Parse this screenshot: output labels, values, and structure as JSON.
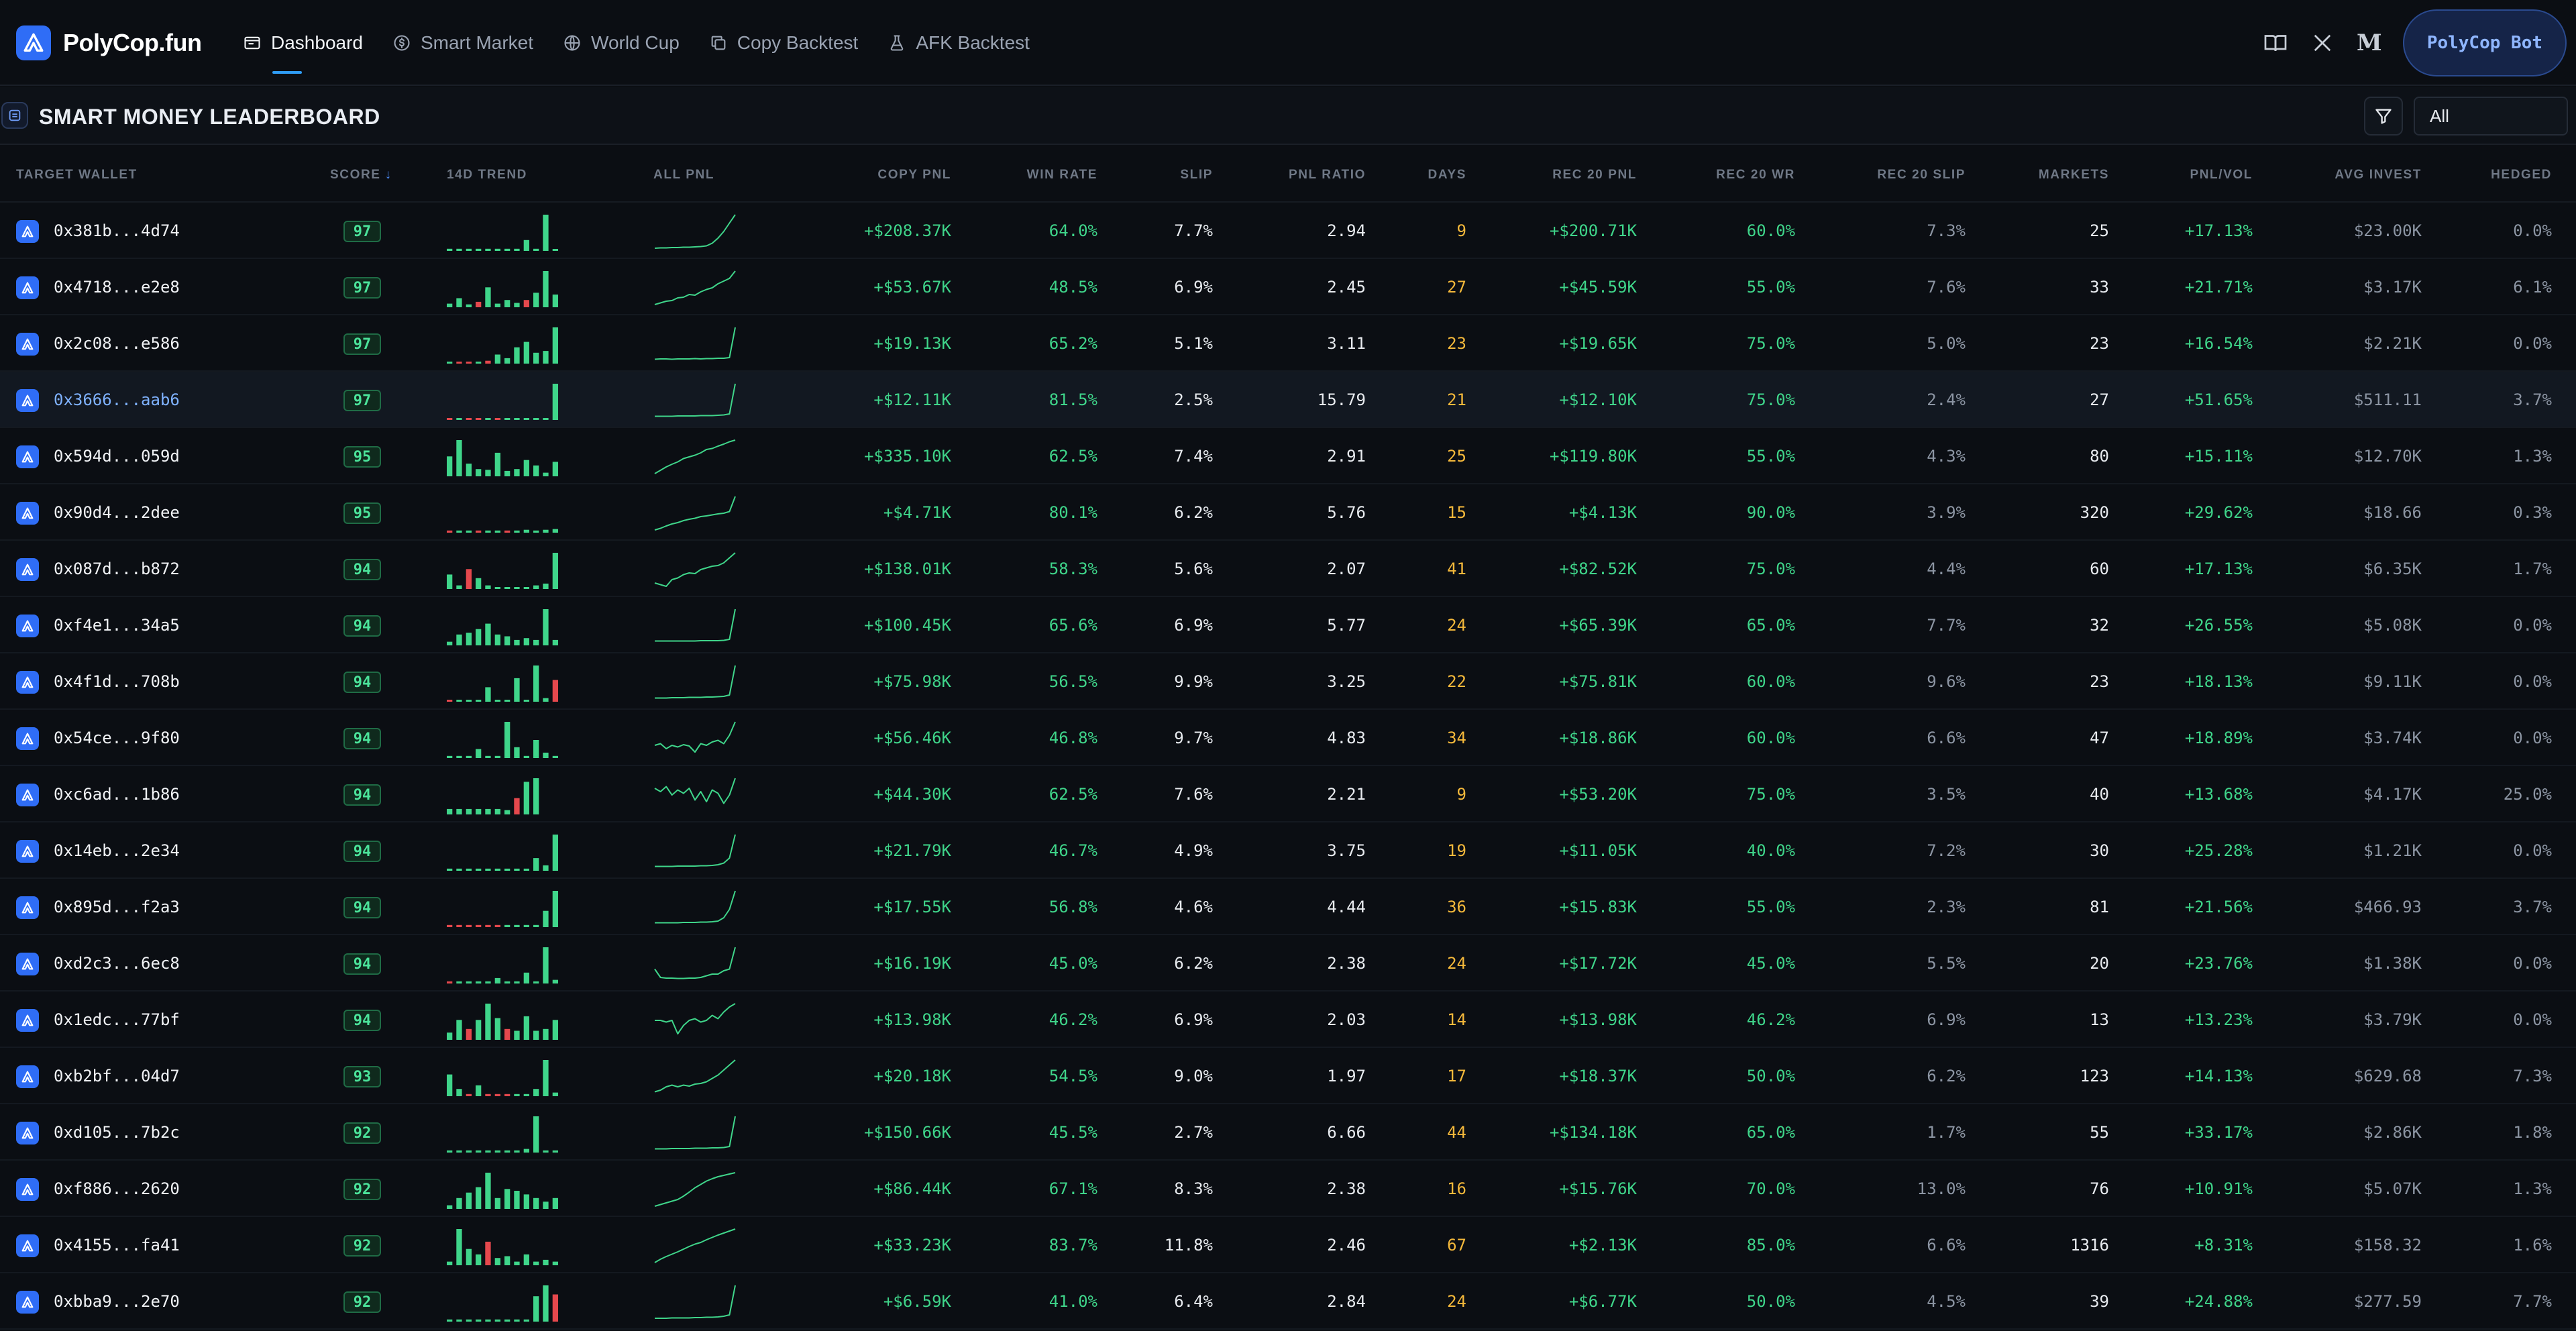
{
  "app": {
    "name": "PolyCop.fun",
    "bot_button": "PolyCop Bot"
  },
  "nav": {
    "tabs": [
      {
        "label": "Dashboard",
        "icon": "dashboard-icon",
        "active": true
      },
      {
        "label": "Smart Market",
        "icon": "dollar-circle-icon",
        "active": false
      },
      {
        "label": "World Cup",
        "icon": "globe-icon",
        "active": false
      },
      {
        "label": "Copy Backtest",
        "icon": "copy-icon",
        "active": false
      },
      {
        "label": "AFK Backtest",
        "icon": "flask-icon",
        "active": false
      }
    ],
    "right_icons": [
      "docs-book-icon",
      "x-twitter-icon",
      "medium-icon"
    ]
  },
  "section": {
    "title": "SMART MONEY LEADERBOARD",
    "filter_icon": "filter-icon",
    "filter_value": "All"
  },
  "colors": {
    "accent": "#2f6df6",
    "positive": "#3fd58a",
    "negative": "#e5484d",
    "days": "#f5b93b"
  },
  "table": {
    "columns": {
      "wallet": "TARGET WALLET",
      "score": "SCORE",
      "trend": "14D TREND",
      "allpnl": "ALL PNL",
      "copy": "COPY PNL",
      "wr": "WIN RATE",
      "slip": "SLIP",
      "ratio": "PNL RATIO",
      "days": "DAYS",
      "r20pnl": "REC 20 PNL",
      "r20wr": "REC 20 WR",
      "r20slip": "REC 20 SLIP",
      "markets": "MARKETS",
      "pv": "PNL/VOL",
      "avg": "AVG INVEST",
      "hedged": "HEDGED"
    },
    "sort": {
      "column": "SCORE",
      "direction": "desc"
    },
    "rows": [
      {
        "wallet": "0x381b...4d74",
        "score": "97",
        "copy": "+$208.37K",
        "wr": "64.0%",
        "slip": "7.7%",
        "ratio": "2.94",
        "days": "9",
        "r20pnl": "+$200.71K",
        "r20wr": "60.0%",
        "r20slip": "7.3%",
        "markets": "25",
        "pv": "+17.13%",
        "avg": "$23.00K",
        "hedged": "0.0%",
        "trend": [
          0.06,
          0.06,
          0.06,
          0.06,
          0.06,
          0.06,
          0.06,
          0.06,
          0.3,
          0.06,
          1.0,
          0.0
        ],
        "trend_neg": [],
        "pnl": [
          0.0,
          0.01,
          0.01,
          0.02,
          0.02,
          0.03,
          0.03,
          0.04,
          0.05,
          0.07,
          0.15,
          0.3,
          0.5,
          0.75,
          1.0
        ]
      },
      {
        "wallet": "0x4718...e2e8",
        "score": "97",
        "copy": "+$53.67K",
        "wr": "48.5%",
        "slip": "6.9%",
        "ratio": "2.45",
        "days": "27",
        "r20pnl": "+$45.59K",
        "r20wr": "55.0%",
        "r20slip": "7.6%",
        "markets": "33",
        "pv": "+21.71%",
        "avg": "$3.17K",
        "hedged": "6.1%",
        "trend": [
          0.1,
          0.25,
          0.08,
          0.15,
          0.55,
          0.1,
          0.2,
          0.12,
          0.2,
          0.4,
          1.0,
          0.35
        ],
        "trend_neg": [
          3,
          8
        ],
        "pnl": [
          0.0,
          0.05,
          0.1,
          0.12,
          0.2,
          0.22,
          0.3,
          0.28,
          0.38,
          0.45,
          0.5,
          0.62,
          0.7,
          0.78,
          1.0
        ]
      },
      {
        "wallet": "0x2c08...e586",
        "score": "97",
        "copy": "+$19.13K",
        "wr": "65.2%",
        "slip": "5.1%",
        "ratio": "3.11",
        "days": "23",
        "r20pnl": "+$19.65K",
        "r20wr": "75.0%",
        "r20slip": "5.0%",
        "markets": "23",
        "pv": "+16.54%",
        "avg": "$2.21K",
        "hedged": "0.0%",
        "trend": [
          0.05,
          0.05,
          0.05,
          0.05,
          0.08,
          0.25,
          0.15,
          0.45,
          0.6,
          0.3,
          0.35,
          1.0
        ],
        "trend_neg": [
          1,
          2,
          4
        ],
        "pnl": [
          0.05,
          0.06,
          0.06,
          0.05,
          0.06,
          0.06,
          0.06,
          0.07,
          0.06,
          0.07,
          0.07,
          0.08,
          0.08,
          0.1,
          1.0
        ]
      },
      {
        "wallet": "0x3666...aab6",
        "score": "97",
        "copy": "+$12.11K",
        "wr": "81.5%",
        "slip": "2.5%",
        "ratio": "15.79",
        "days": "21",
        "r20pnl": "+$12.10K",
        "r20wr": "75.0%",
        "r20slip": "2.4%",
        "markets": "27",
        "pv": "+51.65%",
        "avg": "$511.11",
        "hedged": "3.7%",
        "trend": [
          0.05,
          0.05,
          0.05,
          0.05,
          0.05,
          0.05,
          0.05,
          0.05,
          0.05,
          0.05,
          0.05,
          1.0
        ],
        "trend_neg": [
          0,
          2,
          3,
          5
        ],
        "pnl": [
          0.03,
          0.03,
          0.03,
          0.03,
          0.04,
          0.04,
          0.04,
          0.04,
          0.05,
          0.05,
          0.05,
          0.06,
          0.07,
          0.1,
          1.0
        ]
      },
      {
        "wallet": "0x594d...059d",
        "score": "95",
        "copy": "+$335.10K",
        "wr": "62.5%",
        "slip": "7.4%",
        "ratio": "2.91",
        "days": "25",
        "r20pnl": "+$119.80K",
        "r20wr": "55.0%",
        "r20slip": "4.3%",
        "markets": "80",
        "pv": "+15.11%",
        "avg": "$12.70K",
        "hedged": "1.3%",
        "trend": [
          0.55,
          1.0,
          0.35,
          0.2,
          0.18,
          0.65,
          0.15,
          0.2,
          0.45,
          0.3,
          0.1,
          0.4
        ],
        "trend_neg": [],
        "pnl": [
          0.0,
          0.1,
          0.2,
          0.28,
          0.35,
          0.45,
          0.5,
          0.55,
          0.62,
          0.72,
          0.75,
          0.82,
          0.88,
          0.95,
          1.0
        ]
      },
      {
        "wallet": "0x90d4...2dee",
        "score": "95",
        "copy": "+$4.71K",
        "wr": "80.1%",
        "slip": "6.2%",
        "ratio": "5.76",
        "days": "15",
        "r20pnl": "+$4.13K",
        "r20wr": "90.0%",
        "r20slip": "3.9%",
        "markets": "320",
        "pv": "+29.62%",
        "avg": "$18.66",
        "hedged": "0.3%",
        "trend": [
          0.06,
          0.06,
          0.06,
          0.06,
          0.06,
          0.06,
          0.06,
          0.06,
          0.08,
          0.06,
          0.08,
          0.1
        ],
        "trend_neg": [
          0,
          3,
          6
        ],
        "pnl": [
          0.0,
          0.05,
          0.12,
          0.18,
          0.22,
          0.28,
          0.32,
          0.35,
          0.4,
          0.42,
          0.45,
          0.48,
          0.5,
          0.55,
          1.0
        ]
      },
      {
        "wallet": "0x087d...b872",
        "score": "94",
        "copy": "+$138.01K",
        "wr": "58.3%",
        "slip": "5.6%",
        "ratio": "2.07",
        "days": "41",
        "r20pnl": "+$82.52K",
        "r20wr": "75.0%",
        "r20slip": "4.4%",
        "markets": "60",
        "pv": "+17.13%",
        "avg": "$6.35K",
        "hedged": "1.7%",
        "trend": [
          0.4,
          0.1,
          0.55,
          0.3,
          0.1,
          0.05,
          0.05,
          0.05,
          0.05,
          0.1,
          0.15,
          1.0
        ],
        "trend_neg": [
          2
        ],
        "pnl": [
          0.1,
          0.05,
          0.0,
          0.2,
          0.25,
          0.35,
          0.4,
          0.38,
          0.5,
          0.55,
          0.6,
          0.62,
          0.7,
          0.85,
          1.0
        ]
      },
      {
        "wallet": "0xf4e1...34a5",
        "score": "94",
        "copy": "+$100.45K",
        "wr": "65.6%",
        "slip": "6.9%",
        "ratio": "5.77",
        "days": "24",
        "r20pnl": "+$65.39K",
        "r20wr": "65.0%",
        "r20slip": "7.7%",
        "markets": "32",
        "pv": "+26.55%",
        "avg": "$5.08K",
        "hedged": "0.0%",
        "trend": [
          0.1,
          0.3,
          0.35,
          0.45,
          0.6,
          0.3,
          0.25,
          0.15,
          0.2,
          0.15,
          1.0,
          0.15
        ],
        "trend_neg": [],
        "pnl": [
          0.05,
          0.05,
          0.05,
          0.05,
          0.05,
          0.05,
          0.05,
          0.05,
          0.06,
          0.06,
          0.06,
          0.06,
          0.07,
          0.1,
          1.0
        ]
      },
      {
        "wallet": "0x4f1d...708b",
        "score": "94",
        "copy": "+$75.98K",
        "wr": "56.5%",
        "slip": "9.9%",
        "ratio": "3.25",
        "days": "22",
        "r20pnl": "+$75.81K",
        "r20wr": "60.0%",
        "r20slip": "9.6%",
        "markets": "23",
        "pv": "+18.13%",
        "avg": "$9.11K",
        "hedged": "0.0%",
        "trend": [
          0.05,
          0.05,
          0.05,
          0.05,
          0.4,
          0.05,
          0.05,
          0.65,
          0.05,
          1.0,
          0.1,
          0.6
        ],
        "trend_neg": [
          0,
          11
        ],
        "pnl": [
          0.03,
          0.03,
          0.03,
          0.04,
          0.04,
          0.04,
          0.05,
          0.05,
          0.05,
          0.06,
          0.06,
          0.07,
          0.08,
          0.12,
          1.0
        ]
      },
      {
        "wallet": "0x54ce...9f80",
        "score": "94",
        "copy": "+$56.46K",
        "wr": "46.8%",
        "slip": "9.7%",
        "ratio": "4.83",
        "days": "34",
        "r20pnl": "+$18.86K",
        "r20wr": "60.0%",
        "r20slip": "6.6%",
        "markets": "47",
        "pv": "+18.89%",
        "avg": "$3.74K",
        "hedged": "0.0%",
        "trend": [
          0.06,
          0.06,
          0.06,
          0.25,
          0.06,
          0.06,
          1.0,
          0.3,
          0.06,
          0.5,
          0.15,
          0.06
        ],
        "trend_neg": [],
        "pnl": [
          0.3,
          0.35,
          0.2,
          0.3,
          0.25,
          0.32,
          0.28,
          0.1,
          0.35,
          0.3,
          0.4,
          0.45,
          0.35,
          0.6,
          1.0
        ]
      },
      {
        "wallet": "0xc6ad...1b86",
        "score": "94",
        "copy": "+$44.30K",
        "wr": "62.5%",
        "slip": "7.6%",
        "ratio": "2.21",
        "days": "9",
        "r20pnl": "+$53.20K",
        "r20wr": "75.0%",
        "r20slip": "3.5%",
        "markets": "40",
        "pv": "+13.68%",
        "avg": "$4.17K",
        "hedged": "25.0%",
        "trend": [
          0.15,
          0.15,
          0.15,
          0.15,
          0.15,
          0.15,
          0.12,
          0.45,
          0.9,
          1.0
        ],
        "trend_neg": [
          7
        ],
        "pnl": [
          0.7,
          0.6,
          0.75,
          0.5,
          0.65,
          0.55,
          0.7,
          0.35,
          0.6,
          0.3,
          0.65,
          0.55,
          0.25,
          0.5,
          1.0
        ]
      },
      {
        "wallet": "0x14eb...2e34",
        "score": "94",
        "copy": "+$21.79K",
        "wr": "46.7%",
        "slip": "4.9%",
        "ratio": "3.75",
        "days": "19",
        "r20pnl": "+$11.05K",
        "r20wr": "40.0%",
        "r20slip": "7.2%",
        "markets": "30",
        "pv": "+25.28%",
        "avg": "$1.21K",
        "hedged": "0.0%",
        "trend": [
          0.06,
          0.06,
          0.06,
          0.06,
          0.06,
          0.06,
          0.06,
          0.06,
          0.06,
          0.35,
          0.15,
          1.0
        ],
        "trend_neg": [],
        "pnl": [
          0.05,
          0.05,
          0.05,
          0.05,
          0.06,
          0.06,
          0.06,
          0.06,
          0.07,
          0.07,
          0.08,
          0.1,
          0.15,
          0.3,
          1.0
        ]
      },
      {
        "wallet": "0x895d...f2a3",
        "score": "94",
        "copy": "+$17.55K",
        "wr": "56.8%",
        "slip": "4.6%",
        "ratio": "4.44",
        "days": "36",
        "r20pnl": "+$15.83K",
        "r20wr": "55.0%",
        "r20slip": "2.3%",
        "markets": "81",
        "pv": "+21.56%",
        "avg": "$466.93",
        "hedged": "3.7%",
        "trend": [
          0.06,
          0.06,
          0.06,
          0.06,
          0.06,
          0.06,
          0.06,
          0.06,
          0.06,
          0.06,
          0.45,
          1.0
        ],
        "trend_neg": [
          0,
          1,
          2,
          3,
          4,
          5
        ],
        "pnl": [
          0.05,
          0.05,
          0.05,
          0.05,
          0.05,
          0.06,
          0.06,
          0.06,
          0.07,
          0.07,
          0.08,
          0.1,
          0.2,
          0.45,
          1.0
        ]
      },
      {
        "wallet": "0xd2c3...6ec8",
        "score": "94",
        "copy": "+$16.19K",
        "wr": "45.0%",
        "slip": "6.2%",
        "ratio": "2.38",
        "days": "24",
        "r20pnl": "+$17.72K",
        "r20wr": "45.0%",
        "r20slip": "5.5%",
        "markets": "20",
        "pv": "+23.76%",
        "avg": "$1.38K",
        "hedged": "0.0%",
        "trend": [
          0.06,
          0.06,
          0.06,
          0.06,
          0.06,
          0.15,
          0.06,
          0.06,
          0.3,
          0.06,
          1.0,
          0.1
        ],
        "trend_neg": [
          0
        ],
        "pnl": [
          0.35,
          0.1,
          0.08,
          0.08,
          0.07,
          0.07,
          0.08,
          0.08,
          0.1,
          0.15,
          0.2,
          0.2,
          0.3,
          0.35,
          1.0
        ]
      },
      {
        "wallet": "0x1edc...77bf",
        "score": "94",
        "copy": "+$13.98K",
        "wr": "46.2%",
        "slip": "6.9%",
        "ratio": "2.03",
        "days": "14",
        "r20pnl": "+$13.98K",
        "r20wr": "46.2%",
        "r20slip": "6.9%",
        "markets": "13",
        "pv": "+13.23%",
        "avg": "$3.79K",
        "hedged": "0.0%",
        "trend": [
          0.2,
          0.55,
          0.3,
          0.55,
          1.0,
          0.6,
          0.3,
          0.25,
          0.65,
          0.25,
          0.3,
          0.55
        ],
        "trend_neg": [
          2,
          6
        ],
        "pnl": [
          0.5,
          0.5,
          0.45,
          0.5,
          0.1,
          0.35,
          0.5,
          0.55,
          0.45,
          0.5,
          0.65,
          0.55,
          0.75,
          0.9,
          1.0
        ]
      },
      {
        "wallet": "0xb2bf...04d7",
        "score": "93",
        "copy": "+$20.18K",
        "wr": "54.5%",
        "slip": "9.0%",
        "ratio": "1.97",
        "days": "17",
        "r20pnl": "+$18.37K",
        "r20wr": "50.0%",
        "r20slip": "6.2%",
        "markets": "123",
        "pv": "+14.13%",
        "avg": "$629.68",
        "hedged": "7.3%",
        "trend": [
          0.6,
          0.2,
          0.06,
          0.3,
          0.06,
          0.06,
          0.06,
          0.06,
          0.06,
          0.2,
          1.0,
          0.1
        ],
        "trend_neg": [
          2,
          4,
          5,
          6
        ],
        "pnl": [
          0.05,
          0.1,
          0.2,
          0.25,
          0.2,
          0.25,
          0.22,
          0.28,
          0.3,
          0.35,
          0.45,
          0.55,
          0.7,
          0.85,
          1.0
        ]
      },
      {
        "wallet": "0xd105...7b2c",
        "score": "92",
        "copy": "+$150.66K",
        "wr": "45.5%",
        "slip": "2.7%",
        "ratio": "6.66",
        "days": "44",
        "r20pnl": "+$134.18K",
        "r20wr": "65.0%",
        "r20slip": "1.7%",
        "markets": "55",
        "pv": "+33.17%",
        "avg": "$2.86K",
        "hedged": "1.8%",
        "trend": [
          0.06,
          0.06,
          0.06,
          0.06,
          0.06,
          0.06,
          0.06,
          0.06,
          0.1,
          1.0,
          0.06,
          0.06
        ],
        "trend_neg": [],
        "pnl": [
          0.03,
          0.03,
          0.03,
          0.04,
          0.04,
          0.04,
          0.04,
          0.05,
          0.05,
          0.05,
          0.06,
          0.06,
          0.07,
          0.1,
          1.0
        ]
      },
      {
        "wallet": "0xf886...2620",
        "score": "92",
        "copy": "+$86.44K",
        "wr": "67.1%",
        "slip": "8.3%",
        "ratio": "2.38",
        "days": "16",
        "r20pnl": "+$15.76K",
        "r20wr": "70.0%",
        "r20slip": "13.0%",
        "markets": "76",
        "pv": "+10.91%",
        "avg": "$5.07K",
        "hedged": "1.3%",
        "trend": [
          0.1,
          0.3,
          0.45,
          0.6,
          1.0,
          0.3,
          0.55,
          0.5,
          0.4,
          0.3,
          0.2,
          0.3
        ],
        "trend_neg": [],
        "pnl": [
          0.0,
          0.05,
          0.1,
          0.15,
          0.2,
          0.3,
          0.42,
          0.55,
          0.65,
          0.75,
          0.82,
          0.88,
          0.92,
          0.96,
          1.0
        ]
      },
      {
        "wallet": "0x4155...fa41",
        "score": "92",
        "copy": "+$33.23K",
        "wr": "83.7%",
        "slip": "11.8%",
        "ratio": "2.46",
        "days": "67",
        "r20pnl": "+$2.13K",
        "r20wr": "85.0%",
        "r20slip": "6.6%",
        "markets": "1316",
        "pv": "+8.31%",
        "avg": "$158.32",
        "hedged": "1.6%",
        "trend": [
          0.1,
          1.0,
          0.45,
          0.3,
          0.65,
          0.2,
          0.25,
          0.1,
          0.3,
          0.1,
          0.15,
          0.1
        ],
        "trend_neg": [
          4
        ],
        "pnl": [
          0.0,
          0.1,
          0.18,
          0.25,
          0.32,
          0.4,
          0.48,
          0.55,
          0.6,
          0.68,
          0.75,
          0.82,
          0.88,
          0.94,
          1.0
        ]
      },
      {
        "wallet": "0xbba9...2e70",
        "score": "92",
        "copy": "+$6.59K",
        "wr": "41.0%",
        "slip": "6.4%",
        "ratio": "2.84",
        "days": "24",
        "r20pnl": "+$6.77K",
        "r20wr": "50.0%",
        "r20slip": "4.5%",
        "markets": "39",
        "pv": "+24.88%",
        "avg": "$277.59",
        "hedged": "7.7%",
        "trend": [
          0.06,
          0.06,
          0.06,
          0.06,
          0.06,
          0.06,
          0.06,
          0.06,
          0.06,
          0.7,
          1.0,
          0.75
        ],
        "trend_neg": [
          11
        ],
        "pnl": [
          0.02,
          0.02,
          0.02,
          0.03,
          0.03,
          0.03,
          0.03,
          0.04,
          0.04,
          0.05,
          0.05,
          0.06,
          0.08,
          0.12,
          1.0
        ]
      }
    ]
  }
}
